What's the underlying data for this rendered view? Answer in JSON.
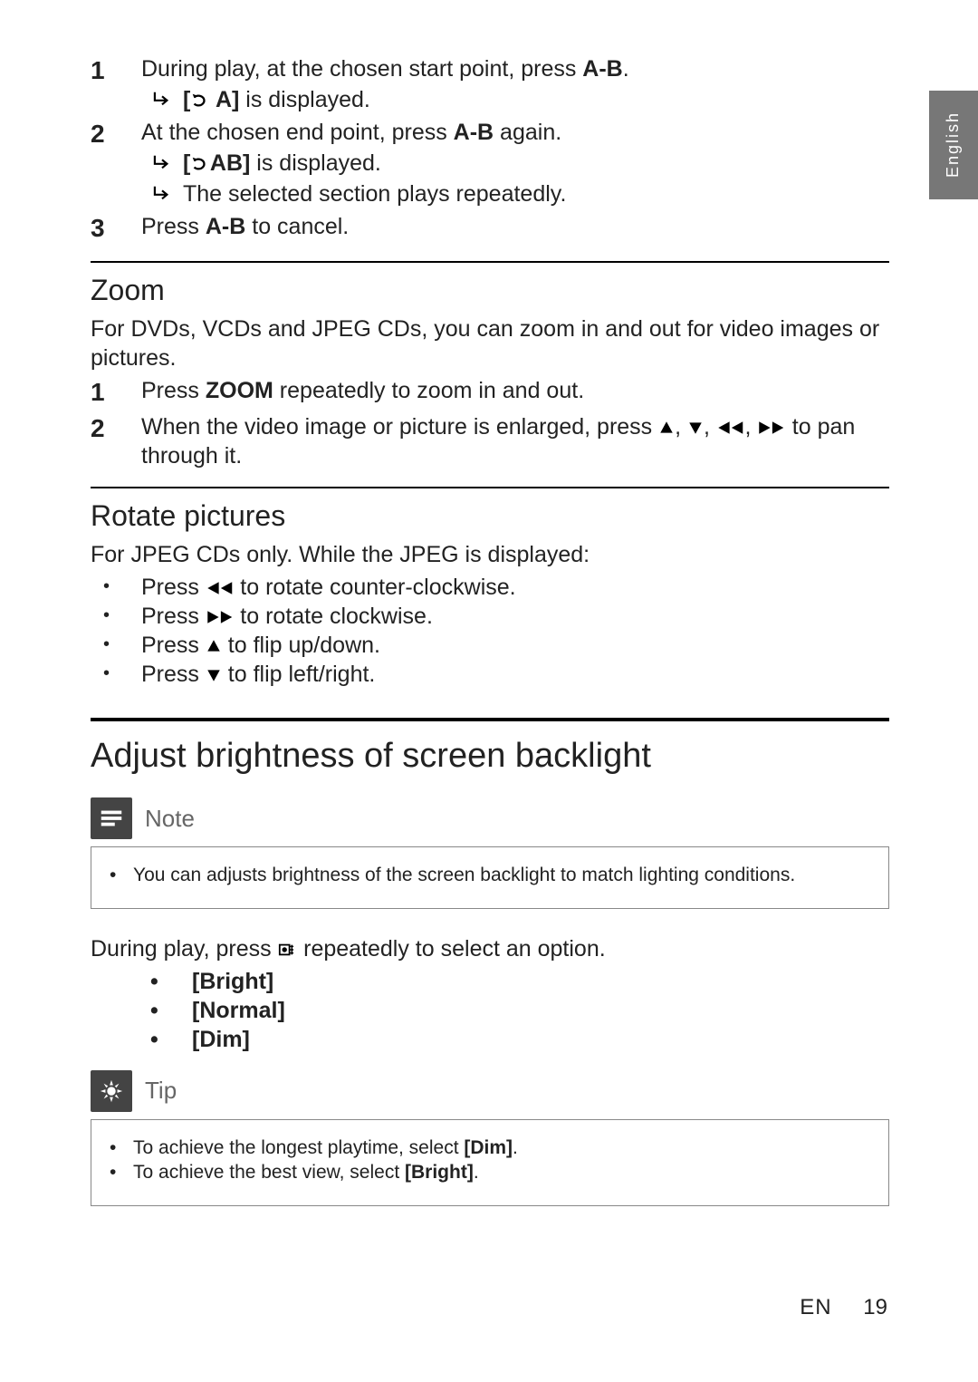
{
  "lang_tab": "English",
  "ab_steps": {
    "s1_num": "1",
    "s1_a": "During play, at the chosen start point, press ",
    "s1_b": "A-B",
    "s1_c": ".",
    "s1_sub_a": "[",
    "s1_sub_b": " A]",
    "s1_sub_c": " is displayed.",
    "s2_num": "2",
    "s2_a": "At the chosen end point, press ",
    "s2_b": "A-B",
    "s2_c": " again.",
    "s2_sub1_a": "[",
    "s2_sub1_b": "AB]",
    "s2_sub1_c": " is displayed.",
    "s2_sub2": "The selected section plays repeatedly.",
    "s3_num": "3",
    "s3_a": "Press ",
    "s3_b": "A-B",
    "s3_c": " to cancel."
  },
  "zoom": {
    "heading": "Zoom",
    "intro": "For DVDs, VCDs and JPEG CDs, you can zoom in and out for video images or pictures.",
    "s1_num": "1",
    "s1_a": "Press ",
    "s1_b": "ZOOM",
    "s1_c": " repeatedly to zoom in and out.",
    "s2_num": "2",
    "s2_a": "When the video image or picture is enlarged, press ",
    "s2_mid": ", ",
    "s2_b": " to pan through it."
  },
  "rotate": {
    "heading": "Rotate pictures",
    "intro": "For JPEG CDs only. While the JPEG is displayed:",
    "b1_a": "Press ",
    "b1_b": " to rotate counter-clockwise.",
    "b2_a": "Press ",
    "b2_b": " to rotate clockwise.",
    "b3_a": "Press ",
    "b3_b": " to flip up/down.",
    "b4_a": "Press ",
    "b4_b": " to flip left/right."
  },
  "brightness": {
    "heading": "Adjust brightness of screen backlight",
    "note_title": "Note",
    "note_text": "You can adjusts brightness of the screen backlight to match lighting conditions.",
    "para_a": "During play, press ",
    "para_b": " repeatedly to select an option.",
    "opt1": "[Bright]",
    "opt2": "[Normal]",
    "opt3": "[Dim]",
    "tip_title": "Tip",
    "tip1_a": "To achieve the longest playtime, select ",
    "tip1_b": "[Dim]",
    "tip1_c": ".",
    "tip2_a": "To achieve the best view, select ",
    "tip2_b": "[Bright]",
    "tip2_c": "."
  },
  "footer": {
    "lang": "EN",
    "page": "19"
  }
}
